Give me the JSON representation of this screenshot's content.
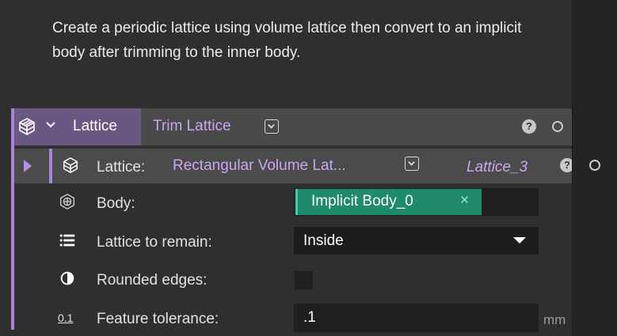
{
  "description": "Create a periodic lattice using volume lattice then convert to an implicit body after trimming to the inner body.",
  "header": {
    "type_label": "Lattice",
    "node_name": "Trim Lattice",
    "help_glyph": "?"
  },
  "lattice_row": {
    "label": "Lattice:",
    "value": "Rectangular Volume Lat...",
    "variable": "Lattice_3",
    "help_glyph": "?"
  },
  "body_row": {
    "label": "Body:",
    "chip_label": "Implicit Body_0",
    "chip_remove": "×"
  },
  "remain_row": {
    "label": "Lattice to remain:",
    "selected": "Inside"
  },
  "rounded_row": {
    "label": "Rounded edges:",
    "checked": false
  },
  "tolerance_row": {
    "icon_text": "0.1",
    "label": "Feature tolerance:",
    "value": ".1",
    "unit": "mm"
  },
  "colors": {
    "accent": "#a982d6",
    "link": "#c8a6f2",
    "chip": "#1f8a6c"
  },
  "icons": [
    "lattice-cube-icon",
    "chevron-down-icon",
    "dropdown-icon",
    "help-icon",
    "status-ring-icon",
    "expand-triangle-icon",
    "body-mesh-icon",
    "list-icon",
    "half-circle-icon",
    "tolerance-icon",
    "close-icon"
  ]
}
